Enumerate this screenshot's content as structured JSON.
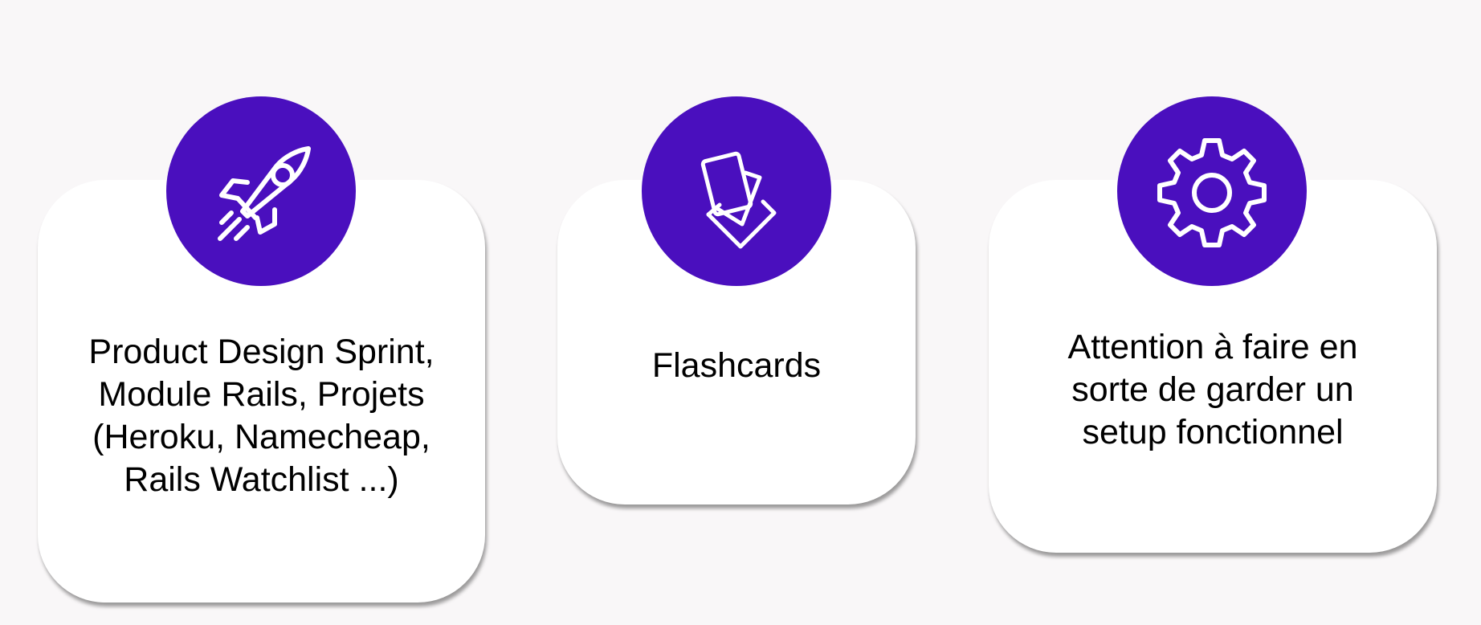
{
  "colors": {
    "background": "#f9f7f8",
    "card": "#ffffff",
    "accent": "#4a0fbe",
    "icon": "#ffffff",
    "text": "#000000"
  },
  "cards": [
    {
      "icon": "rocket-icon",
      "text": "Product Design Sprint,\nModule Rails, Projets\n(Heroku, Namecheap,\nRails Watchlist ...)"
    },
    {
      "icon": "flashcards-icon",
      "text": "Flashcards"
    },
    {
      "icon": "gear-icon",
      "text": "Attention à faire en\nsorte de garder un\nsetup fonctionnel"
    }
  ]
}
